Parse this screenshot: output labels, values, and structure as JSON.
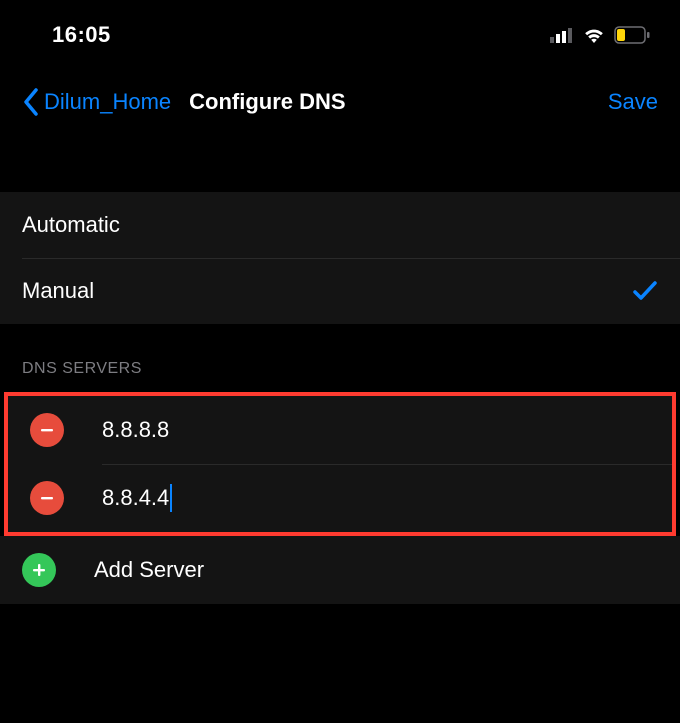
{
  "statusBar": {
    "time": "16:05"
  },
  "nav": {
    "back_label": "Dilum_Home",
    "title": "Configure DNS",
    "save_label": "Save"
  },
  "mode": {
    "options": [
      {
        "label": "Automatic",
        "selected": false
      },
      {
        "label": "Manual",
        "selected": true
      }
    ]
  },
  "dnsSection": {
    "header": "DNS SERVERS",
    "servers": [
      {
        "value": "8.8.8.8",
        "editing": false
      },
      {
        "value": "8.8.4.4",
        "editing": true
      }
    ],
    "add_label": "Add Server"
  },
  "colors": {
    "accent": "#0a84ff",
    "destructive": "#ff3b30",
    "add": "#34c759"
  }
}
